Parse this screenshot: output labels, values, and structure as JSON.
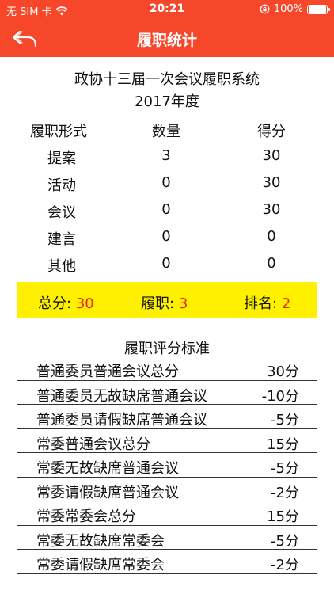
{
  "status": {
    "carrier": "无 SIM 卡",
    "time": "20:21",
    "battery": "100%"
  },
  "nav": {
    "title": "履职统计"
  },
  "header": {
    "line1": "政协十三届一次会议履职系统",
    "line2": "2017年度"
  },
  "stats": {
    "columns": [
      "履职形式",
      "数量",
      "得分"
    ],
    "rows": [
      {
        "type": "提案",
        "count": "3",
        "score": "30"
      },
      {
        "type": "活动",
        "count": "0",
        "score": "30"
      },
      {
        "type": "会议",
        "count": "0",
        "score": "30"
      },
      {
        "type": "建言",
        "count": "0",
        "score": "0"
      },
      {
        "type": "其他",
        "count": "0",
        "score": "0"
      }
    ]
  },
  "summary": {
    "total_label": "总分:",
    "total_value": "30",
    "duty_label": "履职:",
    "duty_value": "3",
    "rank_label": "排名:",
    "rank_value": "2"
  },
  "standards": {
    "title": "履职评分标准",
    "rows": [
      {
        "label": "普通委员普通会议总分",
        "value": "30分"
      },
      {
        "label": "普通委员无故缺席普通会议",
        "value": "-10分"
      },
      {
        "label": "普通委员请假缺席普通会议",
        "value": "-5分"
      },
      {
        "label": "常委普通会议总分",
        "value": "15分"
      },
      {
        "label": "常委无故缺席普通会议",
        "value": "-5分"
      },
      {
        "label": "常委请假缺席普通会议",
        "value": "-2分"
      },
      {
        "label": "常委常委会总分",
        "value": "15分"
      },
      {
        "label": "常委无故缺席常委会",
        "value": "-5分"
      },
      {
        "label": "常委请假缺席常委会",
        "value": "-2分"
      }
    ]
  },
  "colors": {
    "bar": "#f7472b",
    "highlight": "#fff000",
    "accent_red": "#e8241c"
  }
}
